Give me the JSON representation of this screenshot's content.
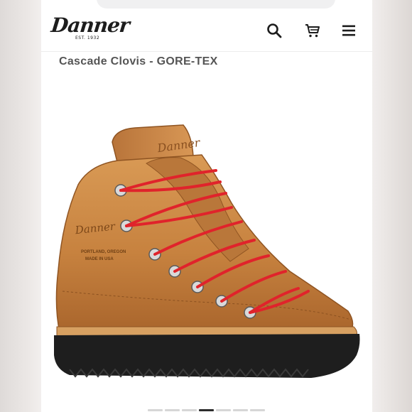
{
  "header": {
    "logo_text": "Danner",
    "logo_subtext": "EST. 1932",
    "icons": [
      "search-icon",
      "cart-icon",
      "menu-icon"
    ]
  },
  "product": {
    "title": "Cascade Clovis - GORE-TEX",
    "boot_stamp_brand": "Danner",
    "boot_stamp_line1": "PORTLAND, OREGON",
    "boot_stamp_line2": "MADE IN USA"
  },
  "gallery": {
    "image_count": 7,
    "active_index": 3
  },
  "colors": {
    "leather": "#c7823f",
    "laces": "#e0232b",
    "sole": "#1e1e1e",
    "logo": "#1d1d1d",
    "title_text": "#555555",
    "active_dot": "#2b2b2b"
  }
}
